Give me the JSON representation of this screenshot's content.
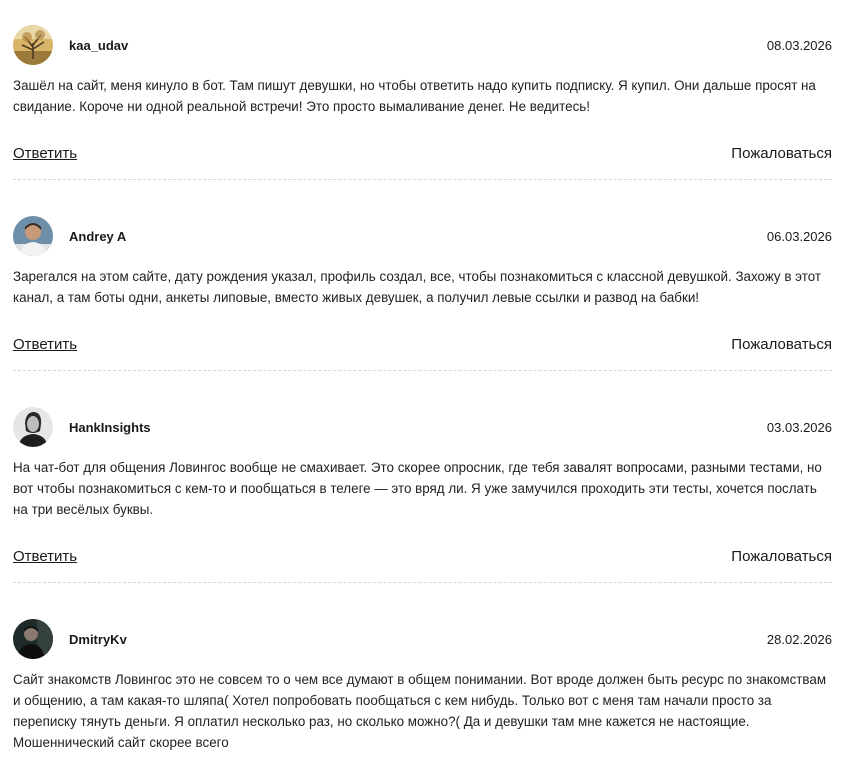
{
  "comments": [
    {
      "author": "kaa_udav",
      "avatar": "photo-tree-avatar",
      "date": "08.03.2026",
      "text": "Зашёл на сайт, меня кинуло в бот. Там пишут девушки, но чтобы ответить надо купить подписку. Я купил. Они дальше просят на свидание. Короче ни одной реальной встречи! Это просто вымаливание денег. Не ведитесь!",
      "reply_label": "Ответить",
      "report_label": "Пожаловаться"
    },
    {
      "author": "Andrey A",
      "avatar": "photo-man-avatar",
      "date": "06.03.2026",
      "text": "Зарегался на этом сайте, дату рождения указал, профиль создал, все, чтобы познакомиться с классной девушкой. Захожу в этот канал, а там боты одни, анкеты липовые, вместо живых девушек, а получил левые ссылки и развод на бабки!",
      "reply_label": "Ответить",
      "report_label": "Пожаловаться"
    },
    {
      "author": "HankInsights",
      "avatar": "photo-bw-man-avatar",
      "date": "03.03.2026",
      "text": "На чат-бот для общения Ловингос вообще не смахивает. Это скорее опросник, где тебя завалят вопросами, разными тестами, но вот чтобы познакомиться с кем-то и пообщаться в телеге — это вряд ли. Я уже замучился проходить эти тесты, хочется послать на три весёлых буквы.",
      "reply_label": "Ответить",
      "report_label": "Пожаловаться"
    },
    {
      "author": "DmitryKv",
      "avatar": "photo-dark-man-avatar",
      "date": "28.02.2026",
      "text": "Сайт знакомств Ловингос это не совсем то о чем все думают в общем понимании. Вот вроде должен быть ресурс по знакомствам и общению, а там какая-то шляпа( Хотел попробовать пообщаться с кем нибудь. Только вот с меня там начали просто за переписку тянуть деньги. Я оплатил несколько раз, но сколько можно?( Да и девушки там мне кажется не настоящие. Мошеннический сайт скорее всего"
    }
  ]
}
